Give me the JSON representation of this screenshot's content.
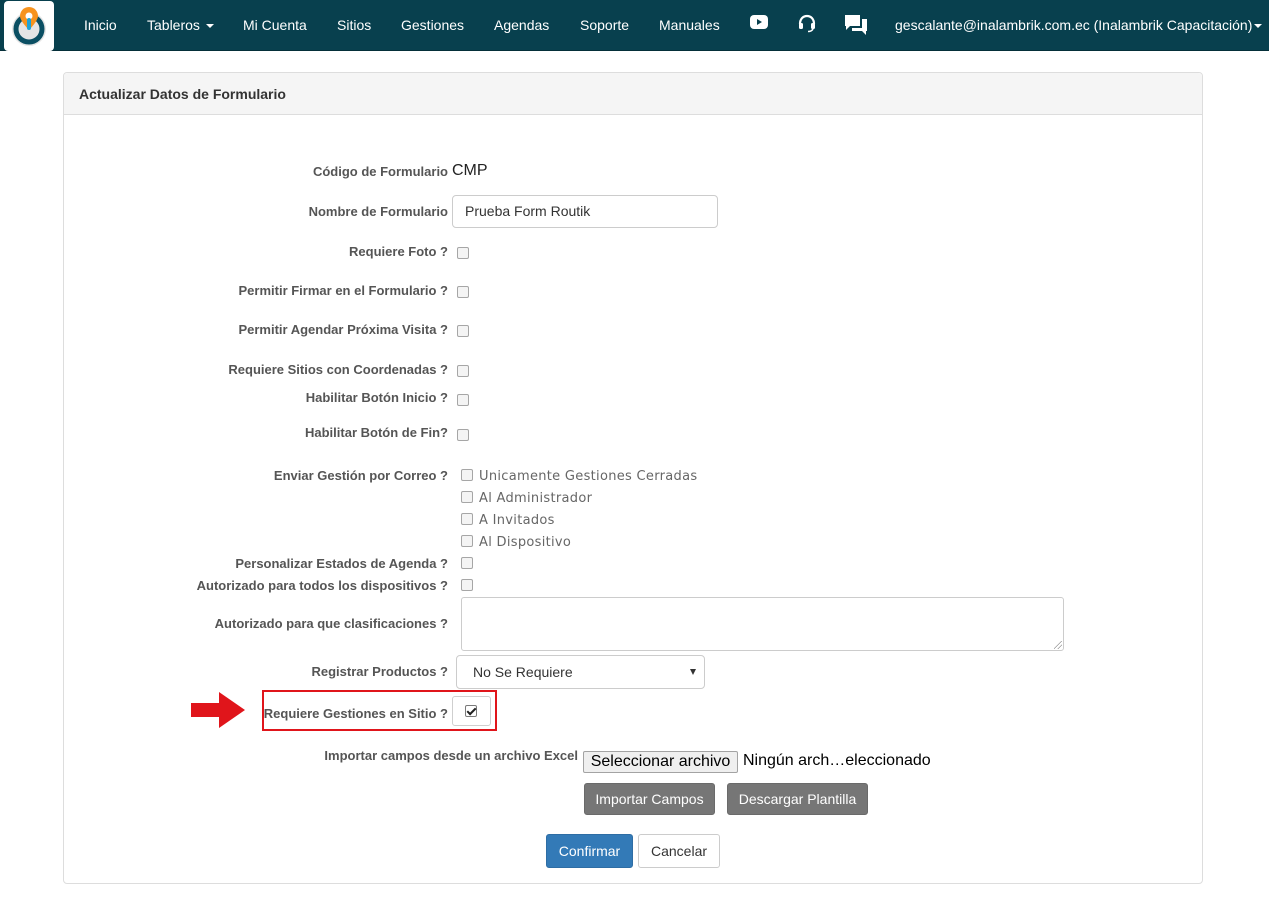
{
  "navbar": {
    "items": [
      {
        "label": "Inicio"
      },
      {
        "label": "Tableros"
      },
      {
        "label": "Mi Cuenta"
      },
      {
        "label": "Sitios"
      },
      {
        "label": "Gestiones"
      },
      {
        "label": "Agendas"
      },
      {
        "label": "Soporte"
      },
      {
        "label": "Manuales"
      }
    ],
    "icons": [
      "youtube-icon",
      "headset-icon",
      "chat-icon"
    ],
    "user": "gescalante@inalambrik.com.ec (Inalambrik Capacitación)",
    "background_color": "#08404e"
  },
  "panel": {
    "title": "Actualizar Datos de Formulario"
  },
  "form": {
    "codigo_label": "Código de Formulario",
    "codigo_value": "CMP",
    "nombre_label": "Nombre de Formulario",
    "nombre_value": "Prueba Form Routik",
    "foto_label": "Requiere Foto ?",
    "firmar_label": "Permitir Firmar en el Formulario ?",
    "agendar_label": "Permitir Agendar Próxima Visita ?",
    "coordenadas_label": "Requiere Sitios con Coordenadas ?",
    "inicio_label": "Habilitar Botón Inicio ?",
    "fin_label": "Habilitar Botón de Fin?",
    "correo_label": "Enviar Gestión por Correo ?",
    "correo_options": [
      {
        "label": "Unicamente Gestiones Cerradas",
        "checked": false
      },
      {
        "label": "Al Administrador",
        "checked": false
      },
      {
        "label": "A Invitados",
        "checked": false
      },
      {
        "label": "Al Dispositivo",
        "checked": false
      }
    ],
    "estados_label": "Personalizar Estados de Agenda ?",
    "autorizado_todos_label": "Autorizado para todos los dispositivos ?",
    "clasificaciones_label": "Autorizado para que clasificaciones ?",
    "productos_label": "Registrar Productos ?",
    "productos_value": "No Se Requiere",
    "gestiones_sitio_label": "Requiere Gestiones en Sitio ?",
    "gestiones_sitio_checked": true,
    "importar_label": "Importar campos desde un archivo Excel",
    "file_button": "Seleccionar archivo",
    "file_status": "Ningún arch…eleccionado",
    "importar_button": "Importar Campos",
    "plantilla_button": "Descargar Plantilla",
    "confirmar_button": "Confirmar",
    "cancelar_button": "Cancelar"
  },
  "colors": {
    "highlight": "#e0151b",
    "primary": "#337ab7",
    "gray_button": "#767676"
  }
}
